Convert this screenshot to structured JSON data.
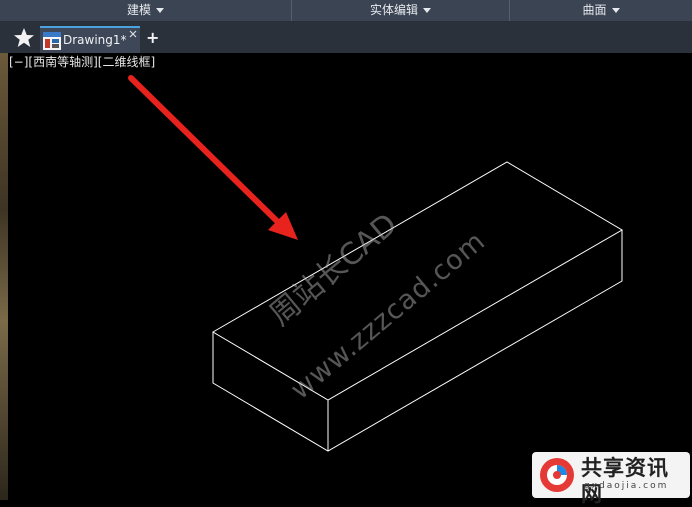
{
  "ribbon": {
    "panels": [
      {
        "label": "建模"
      },
      {
        "label": "实体编辑"
      },
      {
        "label": "曲面"
      }
    ]
  },
  "tabs": {
    "active_label": "Drawing1*",
    "add_symbol": "+"
  },
  "viewport": {
    "view_label": "[−][西南等轴测][二维线框]"
  },
  "watermark": {
    "line1": "周站长CAD",
    "line2": "www.zzzcad.com"
  },
  "brand": {
    "name": "共享资讯网",
    "domain": "gxdaojia.com"
  },
  "colors": {
    "ribbon": "#3b4453",
    "tab_accent": "#4aa3df",
    "arrow": "#e8231e",
    "wire": "#ffffff"
  },
  "icons": [
    "star-icon",
    "drawing-file-icon",
    "close-icon",
    "plus-icon",
    "arrow-annotation",
    "brand-logo"
  ]
}
